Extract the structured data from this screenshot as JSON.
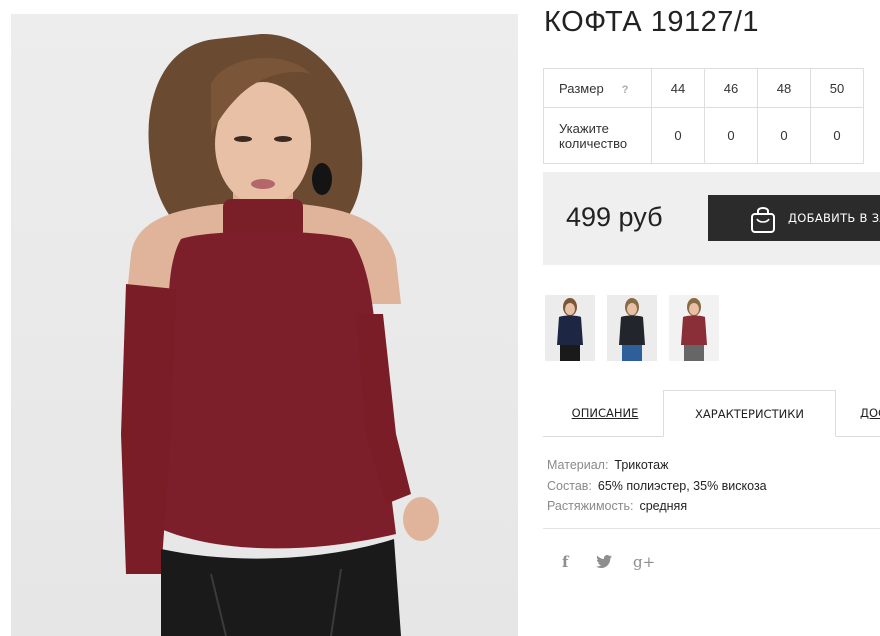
{
  "product": {
    "title": "КОФТА 19127/1"
  },
  "size_table": {
    "size_label": "Размер",
    "help_icon": "?",
    "sizes": [
      "44",
      "46",
      "48",
      "50"
    ],
    "qty_label_line1": "Укажите",
    "qty_label_line2": "количество",
    "quantities": [
      "0",
      "0",
      "0",
      "0"
    ]
  },
  "buy": {
    "price": "499 руб",
    "add_button_label": "ДОБАВИТЬ В ЗАКАЗ",
    "bag_icon": "shopping-bag-icon"
  },
  "thumbnails": [
    {
      "name": "thumb-navy",
      "color": "#1d2744"
    },
    {
      "name": "thumb-black",
      "color": "#22252c"
    },
    {
      "name": "thumb-burgundy",
      "color": "#8a2e38"
    }
  ],
  "tabs": [
    "ОПИСАНИЕ",
    "ХАРАКТЕРИСТИКИ",
    "ДОСТАВКА"
  ],
  "specs": [
    {
      "key": "Материал:",
      "value": "Трикотаж"
    },
    {
      "key": "Состав:",
      "value": "65% полиэстер, 35% вискоза"
    },
    {
      "key": "Растяжимость:",
      "value": "средняя"
    }
  ],
  "social": {
    "facebook": "f",
    "twitter": "twitter-icon",
    "google_plus": "g+"
  },
  "colors": {
    "garment": "#7a1e28",
    "button": "#2b2b2b",
    "price_box": "#efefef"
  }
}
